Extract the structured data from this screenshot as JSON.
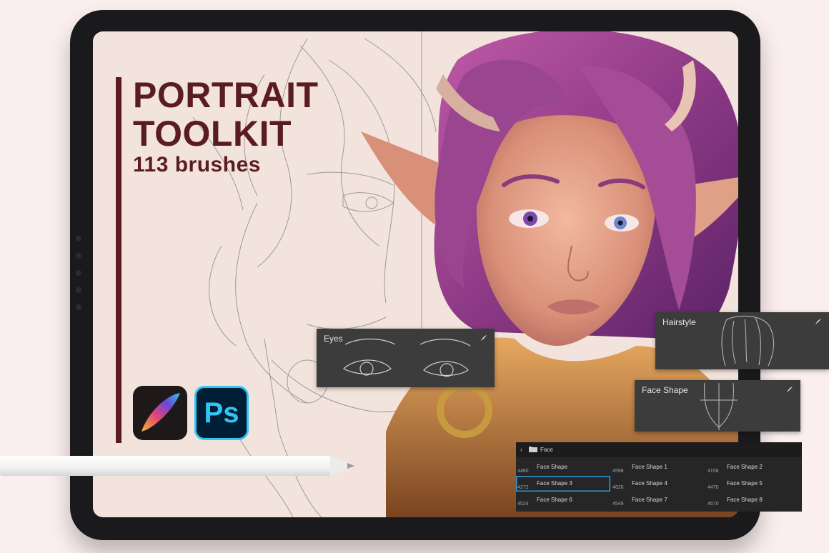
{
  "promo": {
    "title_line1": "PORTRAIT",
    "title_line2": "TOOLKIT",
    "subtitle": "113 brushes",
    "ps_label": "Ps"
  },
  "panels": {
    "eyes": {
      "label": "Eyes"
    },
    "hairstyle": {
      "label": "Hairstyle"
    },
    "face_shape": {
      "label": "Face Shape"
    }
  },
  "brush_list": {
    "folder": "Face",
    "items": [
      {
        "num": "4460",
        "name": "Face Shape",
        "selected": false
      },
      {
        "num": "4598",
        "name": "Face Shape 1",
        "selected": false
      },
      {
        "num": "4158",
        "name": "Face Shape 2",
        "selected": false
      },
      {
        "num": "4272",
        "name": "Face Shape 3",
        "selected": true
      },
      {
        "num": "4626",
        "name": "Face Shape 4",
        "selected": false
      },
      {
        "num": "4470",
        "name": "Face Shape 5",
        "selected": false
      },
      {
        "num": "4524",
        "name": "Face Shape 6",
        "selected": false
      },
      {
        "num": "4549",
        "name": "Face Shape 7",
        "selected": false
      },
      {
        "num": "4670",
        "name": "Face Shape 8",
        "selected": false
      }
    ]
  },
  "colors": {
    "background": "#fbeeee",
    "title": "#5a1c20",
    "selection": "#2f9bd8"
  }
}
